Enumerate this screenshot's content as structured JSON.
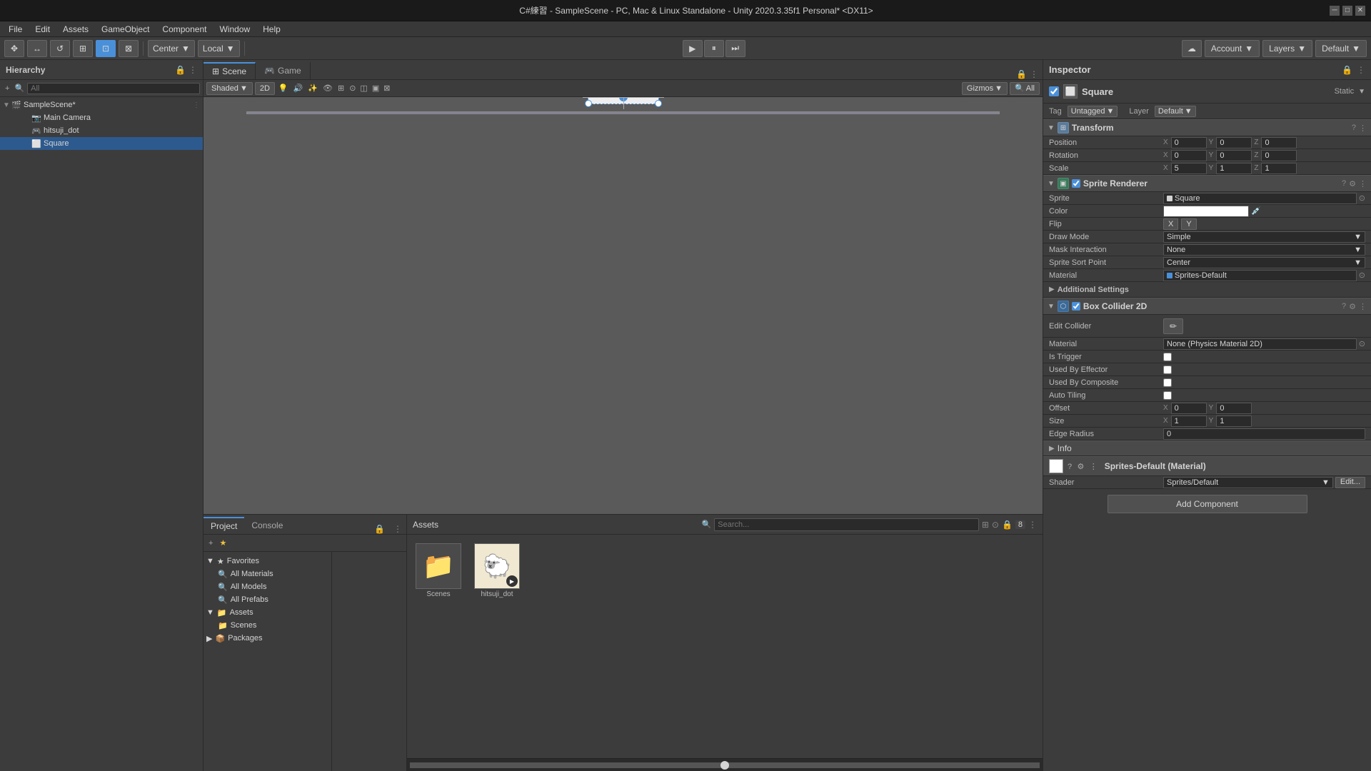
{
  "titlebar": {
    "text": "C#練習 - SampleScene - PC, Mac & Linux Standalone - Unity 2020.3.35f1 Personal* <DX11>",
    "min": "─",
    "max": "□",
    "close": "✕"
  },
  "menubar": {
    "items": [
      "File",
      "Edit",
      "Assets",
      "GameObject",
      "Component",
      "Window",
      "Help"
    ]
  },
  "toolbar": {
    "transform_tools": [
      "✥",
      "↺",
      "↔",
      "⊞",
      "⊠"
    ],
    "pivot": "Center",
    "space": "Local",
    "play": "▶",
    "pause": "⏸",
    "step": "⏭",
    "account_label": "Account",
    "layers_label": "Layers",
    "layout_label": "Default"
  },
  "hierarchy": {
    "title": "Hierarchy",
    "search_placeholder": "All",
    "items": [
      {
        "label": "SampleScene*",
        "indent": 0,
        "icon": "🎬",
        "expanded": true,
        "has_menu": true
      },
      {
        "label": "Main Camera",
        "indent": 1,
        "icon": "📷"
      },
      {
        "label": "hitsuji_dot",
        "indent": 1,
        "icon": "🎮"
      },
      {
        "label": "Square",
        "indent": 1,
        "icon": "⬜",
        "selected": true
      }
    ]
  },
  "scene": {
    "tab_scene": "Scene",
    "tab_game": "Game",
    "shading": "Shaded",
    "resolution": "2D",
    "gizmos": "Gizmos",
    "all": "All"
  },
  "inspector": {
    "title": "Inspector",
    "object_name": "Square",
    "tag_label": "Tag",
    "tag_value": "Untagged",
    "layer_label": "Layer",
    "layer_value": "Default",
    "static_label": "Static",
    "components": {
      "transform": {
        "name": "Transform",
        "position": {
          "label": "Position",
          "x": "0",
          "y": "0",
          "z": "0"
        },
        "rotation": {
          "label": "Rotation",
          "x": "0",
          "y": "0",
          "z": "0"
        },
        "scale": {
          "label": "Scale",
          "x": "5",
          "y": "1",
          "z": "1"
        }
      },
      "sprite_renderer": {
        "name": "Sprite Renderer",
        "sprite_label": "Sprite",
        "sprite_value": "Square",
        "color_label": "Color",
        "flip_label": "Flip",
        "flip_x": "X",
        "flip_y": "Y",
        "draw_mode_label": "Draw Mode",
        "draw_mode_value": "Simple",
        "mask_interaction_label": "Mask Interaction",
        "mask_interaction_value": "None",
        "sprite_sort_point_label": "Sprite Sort Point",
        "sprite_sort_point_value": "Center",
        "material_label": "Material",
        "material_value": "Sprites-Default",
        "additional_settings": "Additional Settings"
      },
      "box_collider_2d": {
        "name": "Box Collider 2D",
        "edit_collider_label": "Edit Collider",
        "material_label": "Material",
        "material_value": "None (Physics Material 2D)",
        "is_trigger_label": "Is Trigger",
        "used_by_effector_label": "Used By Effector",
        "used_by_composite_label": "Used By Composite",
        "auto_tiling_label": "Auto Tiling",
        "offset_label": "Offset",
        "offset_x": "0",
        "offset_y": "0",
        "size_label": "Size",
        "size_x": "1",
        "size_y": "1",
        "edge_radius_label": "Edge Radius",
        "edge_radius_val": "0",
        "info_label": "Info"
      }
    },
    "material_section": {
      "name": "Sprites-Default (Material)",
      "shader_label": "Shader",
      "shader_value": "Sprites/Default",
      "edit_label": "Edit..."
    },
    "add_component": "Add Component"
  },
  "project": {
    "tab_project": "Project",
    "tab_console": "Console",
    "favorites": {
      "label": "Favorites",
      "items": [
        "All Materials",
        "All Models",
        "All Prefabs"
      ]
    },
    "assets_label": "Assets",
    "folders": [
      "Scenes",
      "Packages"
    ],
    "assets_title": "Assets",
    "asset_items": [
      {
        "name": "Scenes",
        "icon": "📁"
      },
      {
        "name": "hitsuji_dot",
        "icon": "🐑"
      },
      {
        "name": "▶",
        "icon": "▶"
      }
    ]
  },
  "statusbar": {
    "scroll_indicator": ""
  }
}
